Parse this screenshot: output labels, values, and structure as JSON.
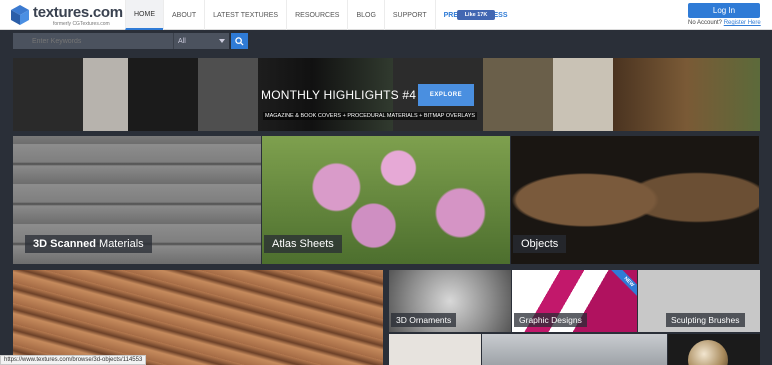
{
  "header": {
    "logo_text": "textures.com",
    "logo_sub": "formerly CGTextures.com",
    "nav": [
      "HOME",
      "ABOUT",
      "LATEST TEXTURES",
      "RESOURCES",
      "BLOG",
      "SUPPORT",
      "PREMIUM ACCESS"
    ],
    "fb_like": "Like 17K",
    "login": "Log In",
    "no_account": "No Account?",
    "register": "Register Here"
  },
  "search": {
    "placeholder": "Enter Keywords",
    "category": "All"
  },
  "banner": {
    "title": "MONTHLY HIGHLIGHTS #4",
    "subtitle": "MAGAZINE & BOOK COVERS + PROCEDURAL MATERIALS + BITMAP OVERLAYS",
    "explore": "EXPLORE"
  },
  "tiles": {
    "scanned_bold": "3D Scanned",
    "scanned_rest": "Materials",
    "atlas": "Atlas Sheets",
    "objects": "Objects",
    "ornaments": "3D Ornaments",
    "graphic": "Graphic Designs",
    "graphic_badge": "NEW",
    "sculpting": "Sculpting Brushes"
  },
  "status_url": "https://www.textures.com/browse/3d-objects/114553",
  "colors": {
    "accent": "#2f7bd6",
    "page_bg": "#2a2f38"
  }
}
